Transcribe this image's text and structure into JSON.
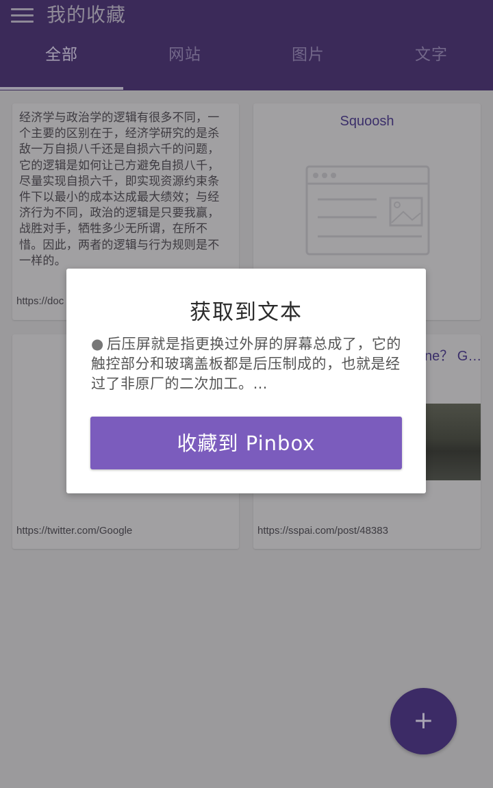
{
  "appbar": {
    "title": "我的收藏",
    "menu_icon": "menu-icon",
    "tabs": [
      {
        "label": "全部"
      },
      {
        "label": "网站"
      },
      {
        "label": "图片"
      },
      {
        "label": "文字"
      }
    ]
  },
  "cards": [
    {
      "text": "经济学与政治学的逻辑有很多不同，一个主要的区别在于，经济学研究的是杀敌一万自损八千还是自损六千的问题，它的逻辑是如何让己方避免自损八千，尽量实现自损六千，即实现资源约束条件下以最小的成本达成最大绩效；与经济行为不同，政治的逻辑是只要我赢，战胜对手，牺牲多少无所谓，在所不惜。因此，两者的逻辑与行为规则是不一样的。",
      "url": "https://doc"
    },
    {
      "title": "Squoosh",
      "icon": "browser-window-icon"
    },
    {
      "url": "https://twitter.com/Google"
    },
    {
      "title": "ne？ G…",
      "url": "https://sspai.com/post/48383"
    }
  ],
  "dialog": {
    "title": "获取到文本",
    "bullet": "●",
    "body": "后压屏就是指更换过外屏的屏幕总成了，它的触控部分和玻璃盖板都是后压制成的，也就是经过了非原厂的二次加工。…",
    "button_label": "收藏到 Pinbox"
  },
  "fab": {
    "label": "+"
  },
  "colors": {
    "appbar": "#3b2a59",
    "dialog_button": "#7b5cbd",
    "scrim_background": "#9b9a9c",
    "fab": "#3c2b66"
  }
}
